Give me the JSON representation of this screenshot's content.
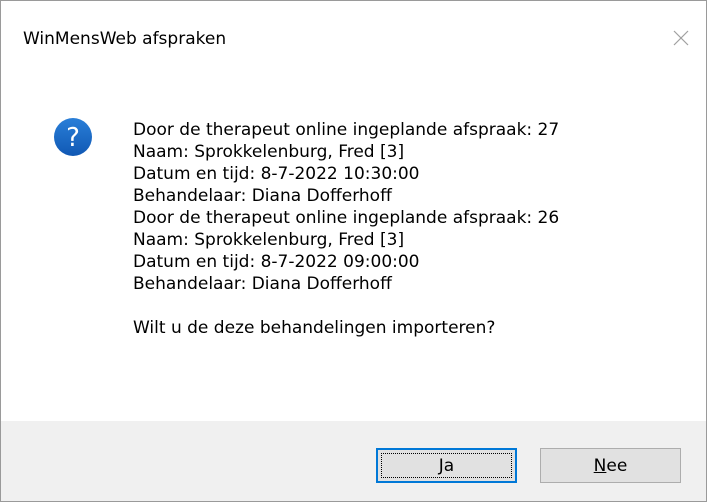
{
  "window": {
    "title": "WinMensWeb afspraken",
    "close_icon": "close-icon"
  },
  "message": {
    "icon": "question-icon",
    "lines": [
      "Door de therapeut online ingeplande afspraak: 27",
      "Naam: Sprokkelenburg, Fred [3]",
      "Datum en tijd: 8-7-2022 10:30:00",
      "Behandelaar: Diana Dofferhoff",
      "Door de therapeut online ingeplande afspraak: 26",
      "Naam: Sprokkelenburg, Fred [3]",
      "Datum en tijd: 8-7-2022 09:00:00",
      "Behandelaar: Diana Dofferhoff"
    ],
    "question": "Wilt u de deze behandelingen importeren?"
  },
  "buttons": {
    "yes": {
      "mnemonic": "J",
      "rest": "a"
    },
    "no": {
      "mnemonic": "N",
      "rest": "ee"
    }
  },
  "colors": {
    "icon_blue": "#1c6dc6",
    "focus_border": "#0078d7",
    "footer_bg": "#f0f0f0",
    "button_bg": "#e1e1e1"
  }
}
